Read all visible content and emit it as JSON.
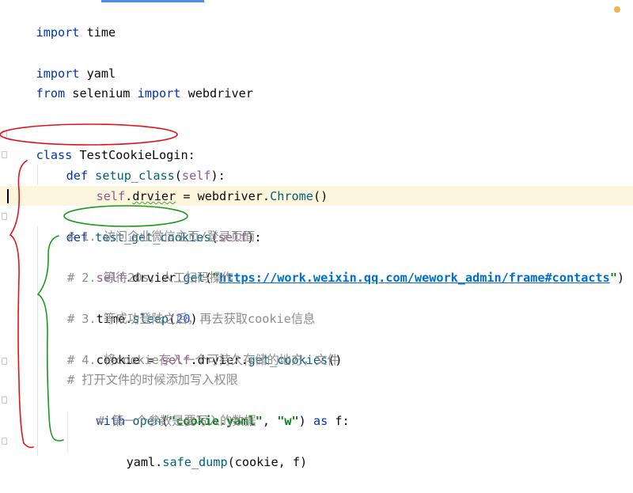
{
  "code": {
    "l1": {
      "kw": "import",
      "rest": " time"
    },
    "l3": {
      "kw": "import",
      "rest": " yaml"
    },
    "l4": {
      "kw1": "from",
      "mod": " selenium ",
      "kw2": "import",
      "rest": " webdriver"
    },
    "l7": {
      "kw": "class",
      "name": " TestCookieLogin:"
    },
    "l8": {
      "kw": "def",
      "fn": "setup_class",
      "p1": "(",
      "self": "self",
      "p2": "):"
    },
    "l9": {
      "self": "self",
      "dot": ".",
      "attr": "drvier",
      "eq": " = webdriver.",
      "cls": "Chrome",
      "paren": "()"
    },
    "l11": {
      "kw": "def",
      "fn": "test_get_cookies",
      "p1": "(",
      "self": "self",
      "p2": "):"
    },
    "l12": {
      "comment": "# 1. 访问企业微信主页/登录页面"
    },
    "l13": {
      "self": "self",
      "mid": ".drvier.",
      "method": "get",
      "p1": "(",
      "q1": "\"",
      "url": "https://work.weixin.qq.com/wework_admin/frame#contacts",
      "q2": "\"",
      "p2": ")"
    },
    "l14": {
      "comment": "# 2. 等待20s，人工扫码操作"
    },
    "l15": {
      "obj": "time.",
      "method": "sleep",
      "p1": "(",
      "num": "20",
      "p2": ")"
    },
    "l16": {
      "comment": "# 3. 等成功登陆之后，再去获取cookie信息"
    },
    "l17": {
      "var": "cookie = ",
      "self": "self",
      "mid": ".drvier.",
      "method": "get_cookies",
      "paren": "()"
    },
    "l18": {
      "comment": "# 4. 将cookie存入一个可持久存储的地方，文件"
    },
    "l19": {
      "comment": "# 打开文件的时候添加写入权限"
    },
    "l20": {
      "kw": "with",
      "sp": " ",
      "fn": "open",
      "p1": "(",
      "s1": "\"cookie.yaml\"",
      "comma": ", ",
      "s2": "\"w\"",
      "p2": ") ",
      "kw2": "as",
      "rest": " f:"
    },
    "l21": {
      "comment": "# 第一个参数是要写入的数据"
    },
    "l22": {
      "obj": "yaml.",
      "method": "safe_dump",
      "args": "(cookie, f)"
    }
  },
  "annotation_colors": {
    "red": "#e0141e",
    "green": "#1a9a1a"
  },
  "theme": {
    "keyword": "#0033b3",
    "function": "#00627a",
    "self": "#94558d",
    "comment": "#8c8c8c",
    "string": "#067d17",
    "number": "#1750eb",
    "current_line": "#fcf6dc"
  }
}
